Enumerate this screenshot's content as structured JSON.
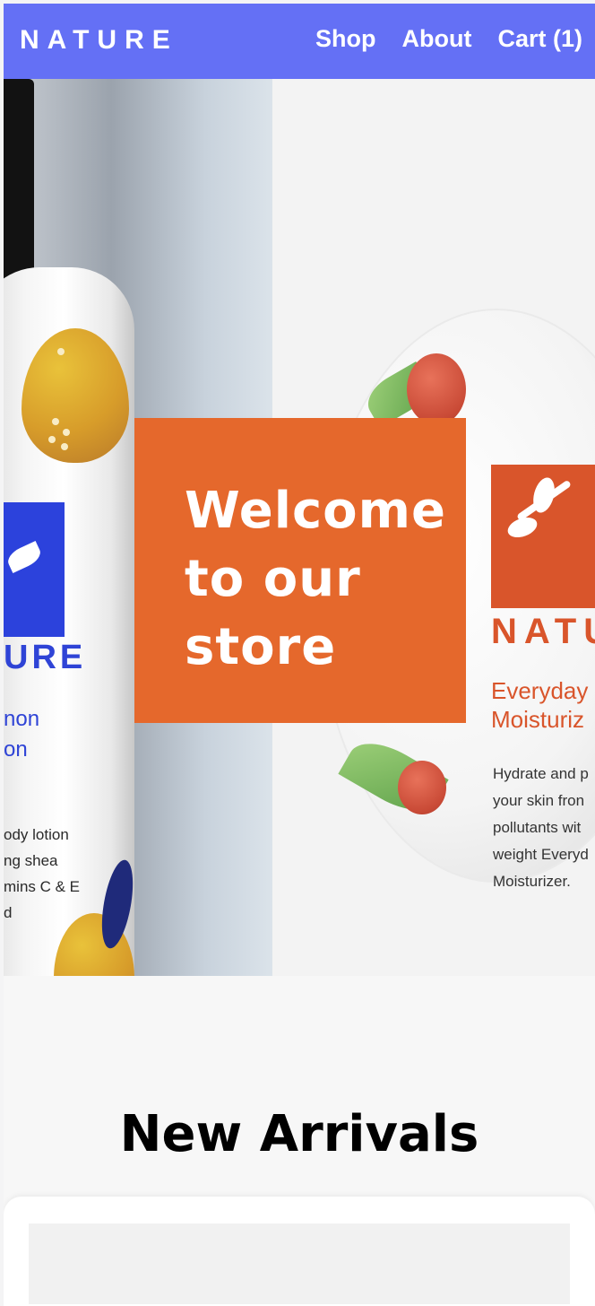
{
  "header": {
    "logo": "NATURE",
    "nav": [
      {
        "label": "Shop"
      },
      {
        "label": "About"
      },
      {
        "label": "Cart (1)"
      }
    ]
  },
  "hero": {
    "heading": "Welcome to our store",
    "bottle": {
      "brand": "URE",
      "name_line1": "non",
      "name_line2": "on",
      "description": [
        "ody lotion",
        "ng shea",
        "mins C & E",
        "d"
      ]
    },
    "jar": {
      "brand": "NATU",
      "title_line1": "Everyday",
      "title_line2": "Moisturiz",
      "description": [
        "Hydrate and p",
        "your skin fron",
        "pollutants wit",
        "weight Everyd",
        "Moisturizer."
      ]
    }
  },
  "new_arrivals": {
    "title": "New Arrivals"
  },
  "colors": {
    "header_bg": "#6470f5",
    "welcome_bg": "#e5682c",
    "bottle_blue": "#2c42dc",
    "jar_orange": "#d9552b"
  }
}
